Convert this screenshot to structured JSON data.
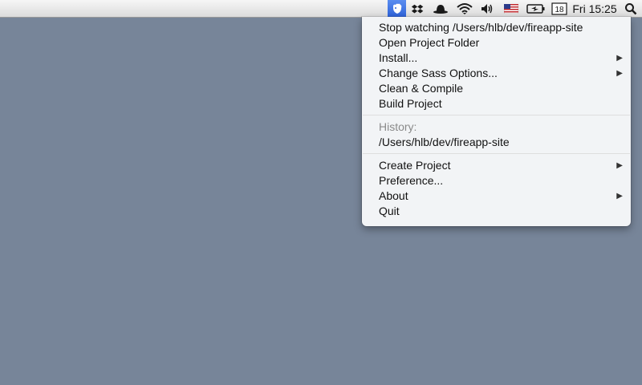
{
  "menubar": {
    "status_icons": [
      {
        "name": "fireapp-icon",
        "active": true
      },
      {
        "name": "dropbox-icon"
      },
      {
        "name": "bowler-hat-icon"
      },
      {
        "name": "wifi-icon"
      },
      {
        "name": "volume-icon"
      },
      {
        "name": "us-flag-icon"
      },
      {
        "name": "battery-icon"
      },
      {
        "name": "calendar-icon",
        "text": "18"
      }
    ],
    "clock": "Fri 15:25",
    "spotlight": "search-icon"
  },
  "menu": {
    "group1": [
      {
        "label": "Stop watching /Users/hlb/dev/fireapp-site",
        "submenu": false
      },
      {
        "label": "Open Project Folder",
        "submenu": false
      },
      {
        "label": "Install...",
        "submenu": true
      },
      {
        "label": "Change Sass Options...",
        "submenu": true
      },
      {
        "label": "Clean & Compile",
        "submenu": false
      },
      {
        "label": "Build Project",
        "submenu": false
      }
    ],
    "history_header": "History:",
    "history": [
      {
        "label": "/Users/hlb/dev/fireapp-site"
      }
    ],
    "group3": [
      {
        "label": "Create Project",
        "submenu": true
      },
      {
        "label": "Preference...",
        "submenu": false
      },
      {
        "label": "About",
        "submenu": true
      },
      {
        "label": "Quit",
        "submenu": false
      }
    ],
    "submenu_arrow": "▶"
  },
  "colors": {
    "desktop": "#778599",
    "menu_bg": "#f5f6f8",
    "highlight": "#2f63d9"
  }
}
